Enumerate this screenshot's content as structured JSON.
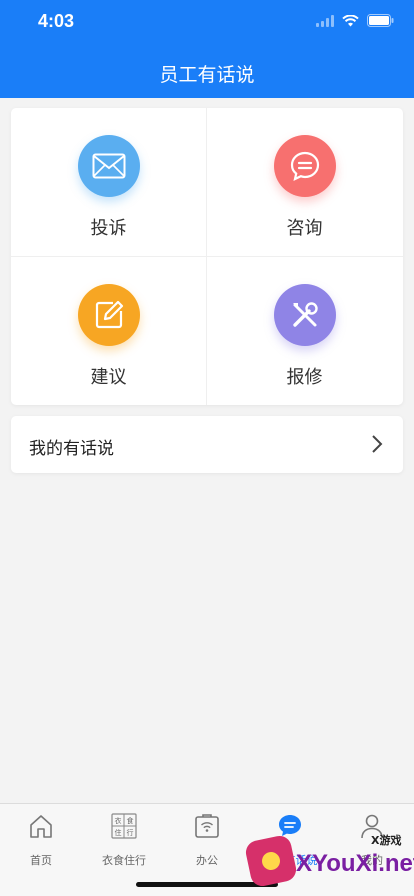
{
  "status_bar": {
    "time": "4:03"
  },
  "header": {
    "title": "员工有话说"
  },
  "grid": {
    "items": [
      {
        "label": "投诉",
        "icon": "envelope-icon",
        "color": "#5aaef0"
      },
      {
        "label": "咨询",
        "icon": "chat-bubble-icon",
        "color": "#f7706f"
      },
      {
        "label": "建议",
        "icon": "edit-icon",
        "color": "#f7a623"
      },
      {
        "label": "报修",
        "icon": "tools-icon",
        "color": "#8f84e6"
      }
    ]
  },
  "my_posts": {
    "label": "我的有话说"
  },
  "tabbar": {
    "tabs": [
      {
        "label": "首页",
        "icon": "home-icon"
      },
      {
        "label": "衣食住行",
        "icon": "grid-services-icon",
        "icon_chars": [
          "衣",
          "食",
          "住",
          "行"
        ]
      },
      {
        "label": "办公",
        "icon": "office-icon"
      },
      {
        "label": "员工有话说",
        "icon": "message-icon",
        "active": true
      },
      {
        "label": "我的",
        "icon": "profile-icon"
      }
    ]
  },
  "watermark": {
    "text": "XYouXi.net",
    "small": "X游戏"
  },
  "colors": {
    "primary": "#1a7ef8",
    "background": "#f3f3f3"
  }
}
